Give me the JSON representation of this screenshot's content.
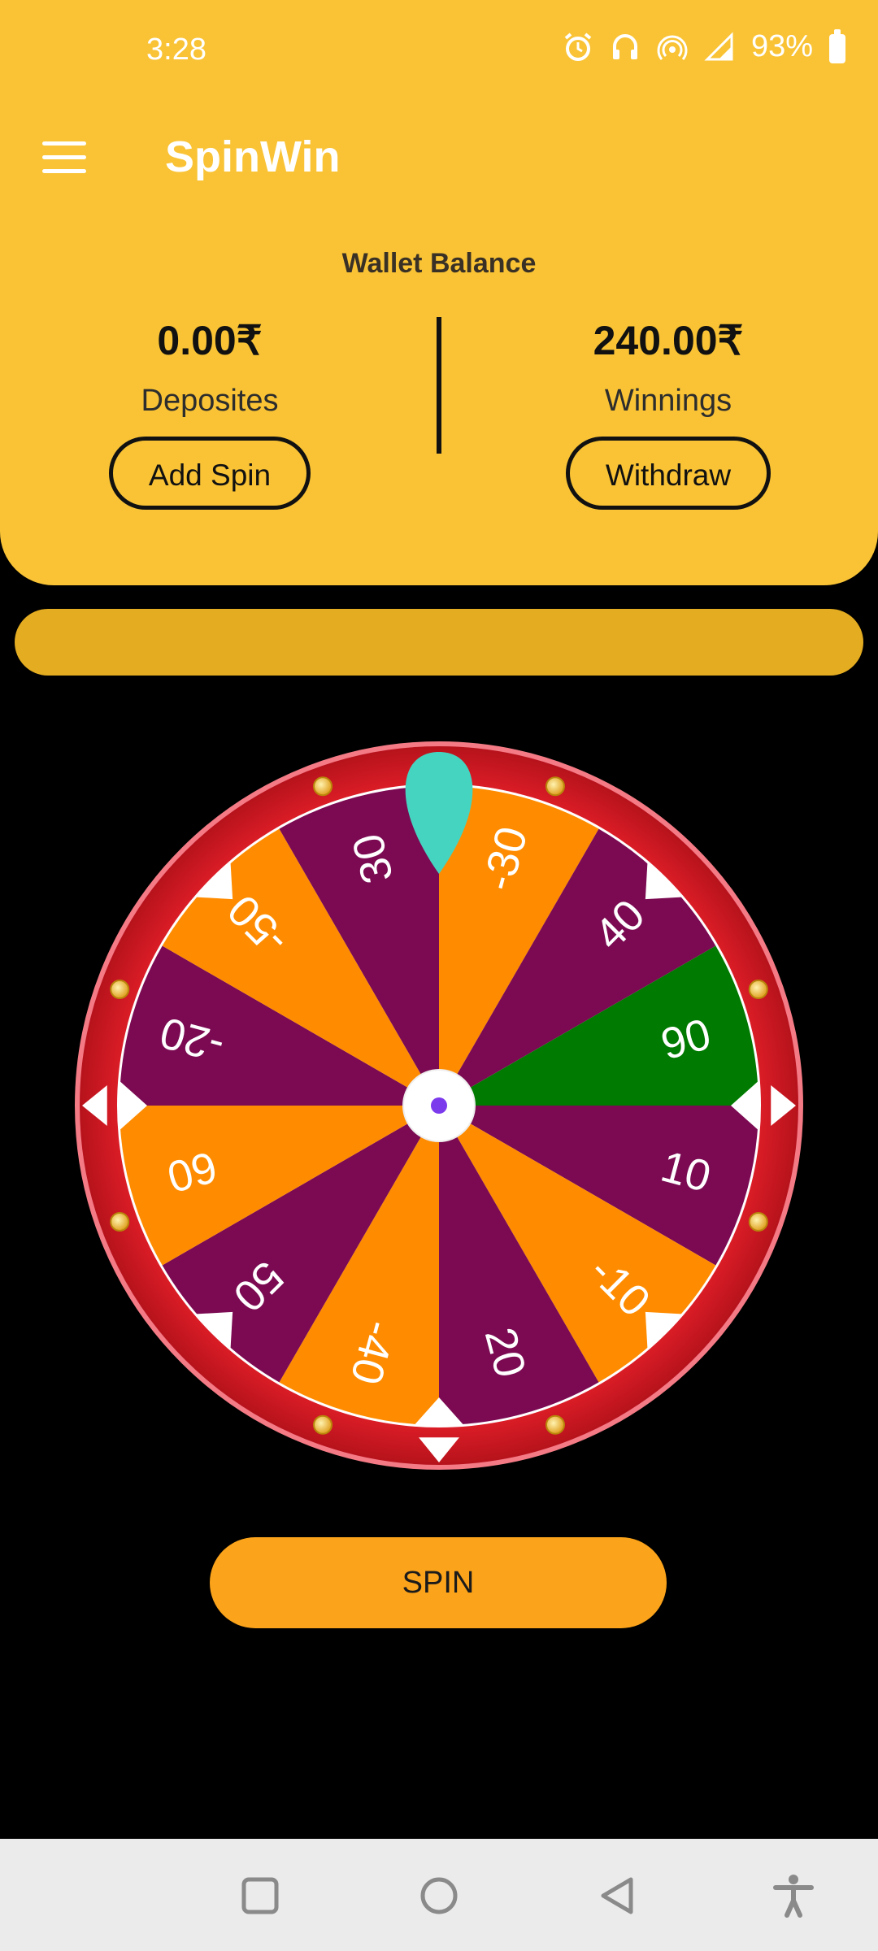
{
  "status_bar": {
    "time": "3:28",
    "battery": "93%",
    "icons": [
      "money-bag-icon",
      "dot-icon",
      "alarm-icon",
      "headset-icon",
      "hotspot-icon",
      "volte-icon",
      "vibrate-icon",
      "signal-icon",
      "data-4g-icon",
      "battery-icon"
    ]
  },
  "app_bar": {
    "title": "SpinWin",
    "menu_icon": "hamburger-menu-icon"
  },
  "wallet": {
    "title": "Wallet Balance",
    "deposits": {
      "amount": "0.00₹",
      "label": "Deposites",
      "button": "Add Spin"
    },
    "winnings": {
      "amount": "240.00₹",
      "label": "Winnings",
      "button": "Withdraw"
    }
  },
  "wheel": {
    "segments": [
      {
        "value": "-30",
        "color": "#FF8C00"
      },
      {
        "value": "40",
        "color": "#7B0A52"
      },
      {
        "value": "90",
        "color": "#007A00"
      },
      {
        "value": "10",
        "color": "#7B0A52"
      },
      {
        "value": "-10",
        "color": "#FF8C00"
      },
      {
        "value": "20",
        "color": "#7B0A52"
      },
      {
        "value": "-40",
        "color": "#FF8C00"
      },
      {
        "value": "50",
        "color": "#7B0A52"
      },
      {
        "value": "60",
        "color": "#FF8C00"
      },
      {
        "value": "-20",
        "color": "#7B0A52"
      },
      {
        "value": "-50",
        "color": "#FF8C00"
      },
      {
        "value": "30",
        "color": "#7B0A52"
      }
    ],
    "rim_color": "#E8202A",
    "pointer_color": "#45D4C0",
    "hub_dot_color": "#7C3AED"
  },
  "spin_button": {
    "label": "SPIN"
  },
  "nav_bar": {
    "icons": [
      "recent-apps-icon",
      "home-icon",
      "back-icon",
      "accessibility-icon"
    ]
  }
}
